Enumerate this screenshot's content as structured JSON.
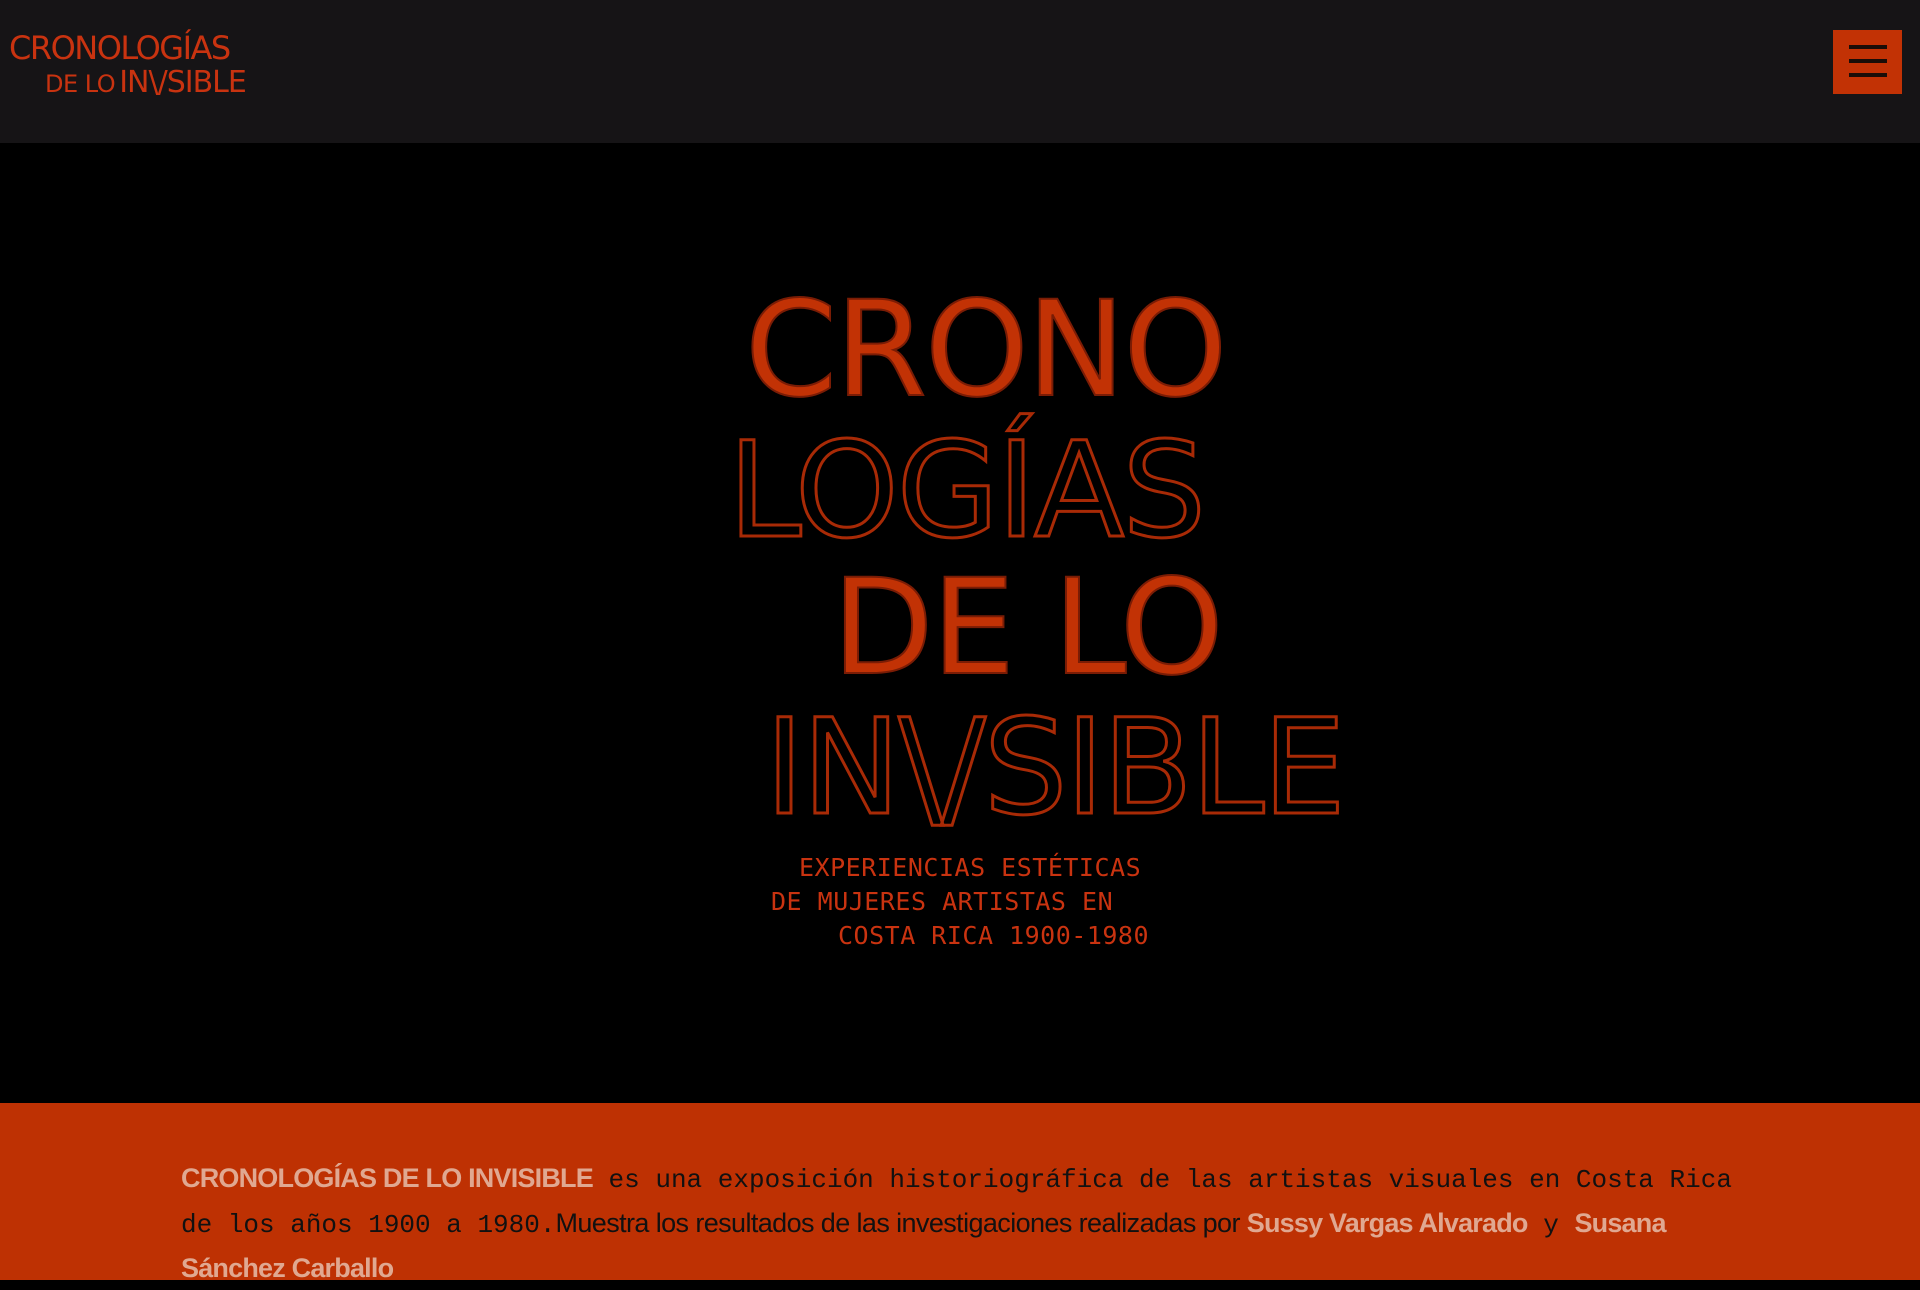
{
  "header": {
    "logo_line1": "CRONOLOGÍAS",
    "logo_line2_small": "DE LO",
    "logo_line2_big": "IN\\/SIBLE",
    "menu_icon": "hamburger-icon"
  },
  "hero": {
    "title_lines": [
      "CRONO",
      "LOGÍAS",
      "DE LO",
      "IN\\/SIBLE"
    ],
    "subtitle_lines": [
      "EXPERIENCIAS ESTÉTICAS",
      "DE MUJERES ARTISTAS EN",
      "COSTA RICA 1900-1980"
    ]
  },
  "intro": {
    "exhibition_name": "CRONOLOGÍAS DE LO INVISIBLE",
    "text_mono": " es una exposición historiográfica de las artistas visuales en Costa Rica de los años 1900 a 1980.",
    "text_sans": "Muestra los resultados de las investigaciones realizadas por ",
    "author1": "Sussy Vargas Alvarado",
    "conjunction": " y ",
    "author2": "Susana Sánchez Carballo"
  },
  "colors": {
    "accent": "#c23205",
    "header_bg": "#161416",
    "hero_bg": "#000000",
    "intro_bg": "#be3103",
    "highlight_text": "#e0a891"
  }
}
